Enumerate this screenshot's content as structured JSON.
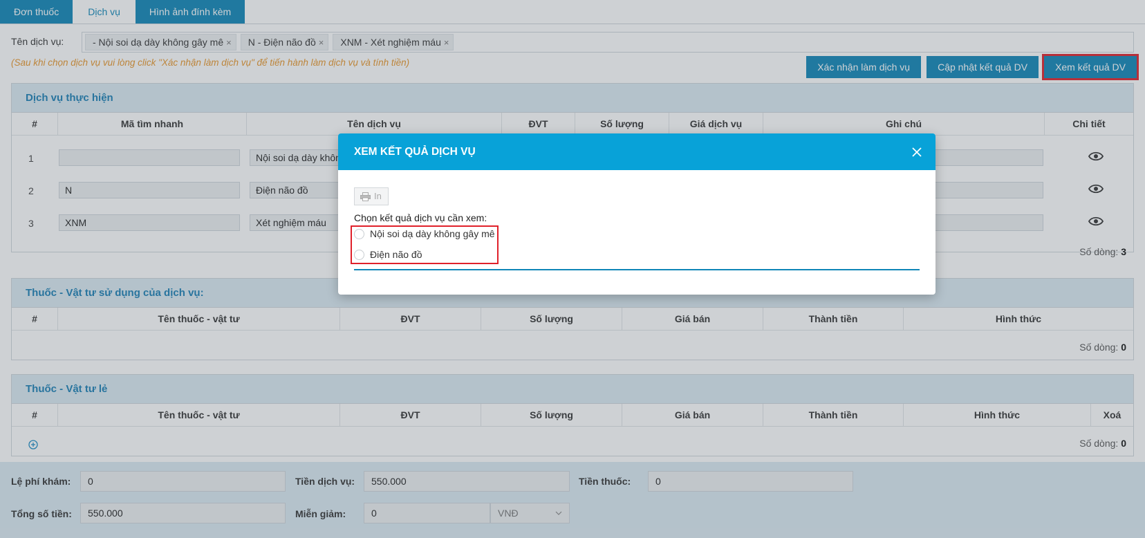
{
  "tabs": [
    {
      "label": "Đơn thuốc"
    },
    {
      "label": "Dịch vụ"
    },
    {
      "label": "Hình ảnh đính kèm"
    }
  ],
  "service_select": {
    "label": "Tên dịch vụ:",
    "chips": [
      "- Nội soi dạ dày không gây mê",
      "N - Điện não đồ",
      "XNM - Xét nghiệm máu"
    ],
    "remove_icon": "×"
  },
  "hint": "(Sau khi chọn dịch vụ vui lòng click \"Xác nhận làm dịch vụ\" để tiến hành làm dịch vụ và tính tiền)",
  "actions": {
    "confirm": "Xác nhận làm dịch vụ",
    "update": "Cập nhật kết quả DV",
    "view": "Xem kết quả DV"
  },
  "services_panel": {
    "title": "Dịch vụ thực hiện",
    "columns": [
      "#",
      "Mã tìm nhanh",
      "Tên dịch vụ",
      "ĐVT",
      "Số lượng",
      "Giá dịch vụ",
      "Ghi chú",
      "Chi tiết"
    ],
    "rows": [
      {
        "num": "1",
        "code": "",
        "name": "Nội soi dạ dày khôn"
      },
      {
        "num": "2",
        "code": "N",
        "name": "Điện não đồ"
      },
      {
        "num": "3",
        "code": "XNM",
        "name": "Xét nghiệm máu"
      }
    ],
    "count_label": "Số dòng:",
    "count": "3"
  },
  "materials_panel": {
    "title": "Thuốc - Vật tư sử dụng của dịch vụ:",
    "columns": [
      "#",
      "Tên thuốc - vật tư",
      "ĐVT",
      "Số lượng",
      "Giá bán",
      "Thành tiền",
      "Hình thức"
    ],
    "count_label": "Số dòng:",
    "count": "0"
  },
  "retail_panel": {
    "title": "Thuốc - Vật tư lẻ",
    "columns": [
      "#",
      "Tên thuốc - vật tư",
      "ĐVT",
      "Số lượng",
      "Giá bán",
      "Thành tiền",
      "Hình thức",
      "Xoá"
    ],
    "count_label": "Số dòng:",
    "count": "0"
  },
  "totals": {
    "exam_fee_label": "Lệ phí khám:",
    "exam_fee": "0",
    "service_fee_label": "Tiền dịch vụ:",
    "service_fee": "550.000",
    "drug_fee_label": "Tiền thuốc:",
    "drug_fee": "0",
    "total_label": "Tổng số tiền:",
    "total": "550.000",
    "discount_label": "Miễn giảm:",
    "discount": "0",
    "currency": "VNĐ"
  },
  "modal": {
    "title": "XEM KẾT QUẢ DỊCH VỤ",
    "print": "In",
    "choose_label": "Chọn kết quả dịch vụ cần xem:",
    "options": [
      "Nội soi dạ dày không gây mê",
      "Điện não đồ"
    ]
  },
  "colors": {
    "primary": "#0f86b7",
    "modal_header": "#08a2d8",
    "highlight": "#e0202a",
    "hint": "#e8962b"
  }
}
